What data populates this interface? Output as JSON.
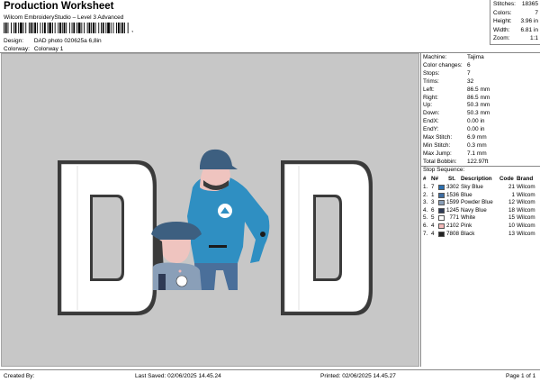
{
  "header": {
    "title": "Production Worksheet",
    "subtitle": "Wilcom EmbroideryStudio – Level 3 Advanced",
    "barcode_suffix": ",",
    "design_label": "Design:",
    "design_value": "DAD photo 020625a 6,8in",
    "colorway_label": "Colorway:",
    "colorway_value": "Colorway 1"
  },
  "stats": [
    {
      "label": "Stitches:",
      "value": "18365"
    },
    {
      "label": "Colors:",
      "value": "7"
    },
    {
      "label": "Height:",
      "value": "3.96 in"
    },
    {
      "label": "Width:",
      "value": "6.81 in"
    },
    {
      "label": "Zoom:",
      "value": "1:1"
    }
  ],
  "machine_info": [
    {
      "label": "Machine:",
      "value": "Tajima"
    },
    {
      "label": "Color changes:",
      "value": "6"
    },
    {
      "label": "Stops:",
      "value": "7"
    },
    {
      "label": "Trims:",
      "value": "32"
    },
    {
      "label": "Left:",
      "value": "86.5 mm"
    },
    {
      "label": "Right:",
      "value": "86.5 mm"
    },
    {
      "label": "Up:",
      "value": "50.3 mm"
    },
    {
      "label": "Down:",
      "value": "50.3 mm"
    },
    {
      "label": "EndX:",
      "value": "0.00 in"
    },
    {
      "label": "EndY:",
      "value": "0.00 in"
    },
    {
      "label": "Max Stitch:",
      "value": "6.9 mm"
    },
    {
      "label": "Min Stitch:",
      "value": "0.3 mm"
    },
    {
      "label": "Max Jump:",
      "value": "7.1 mm"
    },
    {
      "label": "Total Bobbin:",
      "value": "122.97ft"
    }
  ],
  "stop_sequence": {
    "label": "Stop Sequence:",
    "headers": {
      "idx": "#",
      "n": "N#",
      "st": "St.",
      "desc": "Description",
      "code": "Code",
      "brand": "Brand"
    },
    "rows": [
      {
        "idx": "1.",
        "n": "7",
        "color": "#2a6fb0",
        "st": "3302",
        "desc": "Sky Blue",
        "code": "21",
        "brand": "Wilcom"
      },
      {
        "idx": "2.",
        "n": "1",
        "color": "#3f6ea3",
        "st": "1536",
        "desc": "Blue",
        "code": "1",
        "brand": "Wilcom"
      },
      {
        "idx": "3.",
        "n": "3",
        "color": "#8a9fb8",
        "st": "1599",
        "desc": "Powder Blue",
        "code": "12",
        "brand": "Wilcom"
      },
      {
        "idx": "4.",
        "n": "6",
        "color": "#2e3a55",
        "st": "1245",
        "desc": "Navy Blue",
        "code": "18",
        "brand": "Wilcom"
      },
      {
        "idx": "5.",
        "n": "5",
        "color": "#ffffff",
        "st": "771",
        "desc": "White",
        "code": "15",
        "brand": "Wilcom"
      },
      {
        "idx": "6.",
        "n": "4",
        "color": "#f2b8b8",
        "st": "2102",
        "desc": "Pink",
        "code": "10",
        "brand": "Wilcom"
      },
      {
        "idx": "7.",
        "n": "4",
        "color": "#222222",
        "st": "7808",
        "desc": "Black",
        "code": "13",
        "brand": "Wilcom"
      }
    ]
  },
  "footer": {
    "created_by": "Created By:",
    "last_saved": "Last Saved: 02/06/2025 14.45.24",
    "printed": "Printed: 02/06/2025 14.45.27",
    "page": "Page 1 of 1"
  },
  "colors": {
    "canvas_bg": "#c7c7c7",
    "letter_outline": "#3a3a3a",
    "letter_fill": "#ffffff",
    "shirt_blue": "#2f8fc2",
    "jeans_blue": "#4a6f9a"
  },
  "design_preview": {
    "letters": [
      "D",
      "D"
    ]
  }
}
